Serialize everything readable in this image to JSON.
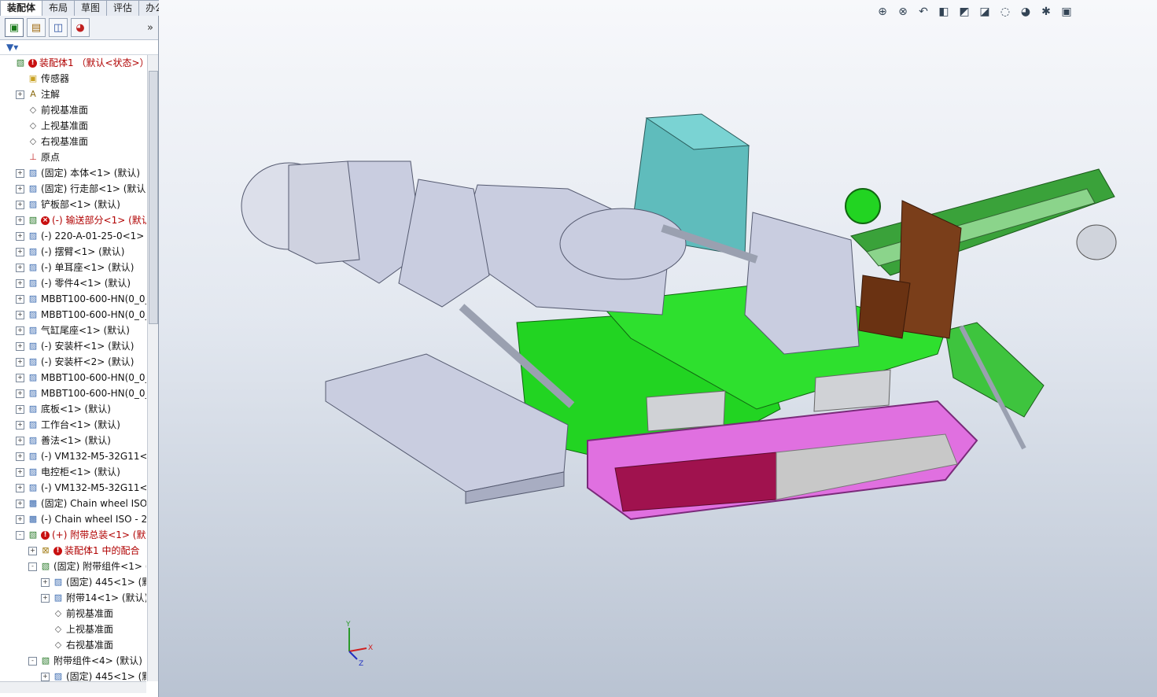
{
  "tabs": [
    "装配体",
    "布局",
    "草图",
    "评估",
    "办公室产品"
  ],
  "feature_tree": [
    {
      "label": "装配体1 （默认<状态>）",
      "indent": 0,
      "expander": "",
      "icon": "assembly-icon",
      "error": true,
      "red": true
    },
    {
      "label": "传感器",
      "indent": 1,
      "expander": "",
      "icon": "sensor-folder-icon"
    },
    {
      "label": "注解",
      "indent": 1,
      "expander": "+",
      "icon": "annotations-icon"
    },
    {
      "label": "前视基准面",
      "indent": 1,
      "expander": "",
      "icon": "plane-icon"
    },
    {
      "label": "上视基准面",
      "indent": 1,
      "expander": "",
      "icon": "plane-icon"
    },
    {
      "label": "右视基准面",
      "indent": 1,
      "expander": "",
      "icon": "plane-icon"
    },
    {
      "label": "原点",
      "indent": 1,
      "expander": "",
      "icon": "origin-icon"
    },
    {
      "label": "(固定) 本体<1> (默认)",
      "indent": 1,
      "expander": "+",
      "icon": "component-icon"
    },
    {
      "label": "(固定) 行走部<1> (默认)",
      "indent": 1,
      "expander": "+",
      "icon": "component-icon"
    },
    {
      "label": "铲板部<1> (默认)",
      "indent": 1,
      "expander": "+",
      "icon": "component-icon"
    },
    {
      "label": "(-) 输送部分<1> (默认",
      "indent": 1,
      "expander": "+",
      "icon": "assembly-icon",
      "error_x": true,
      "red": true
    },
    {
      "label": "(-) 220-A-01-25-0<1> (",
      "indent": 1,
      "expander": "+",
      "icon": "component-icon"
    },
    {
      "label": "(-) 摆臂<1> (默认)",
      "indent": 1,
      "expander": "+",
      "icon": "component-icon"
    },
    {
      "label": "(-) 单耳座<1> (默认)",
      "indent": 1,
      "expander": "+",
      "icon": "component-icon"
    },
    {
      "label": "(-) 零件4<1> (默认)",
      "indent": 1,
      "expander": "+",
      "icon": "component-icon"
    },
    {
      "label": "MBBT100-600-HN(0_0_(",
      "indent": 1,
      "expander": "+",
      "icon": "component-icon"
    },
    {
      "label": "MBBT100-600-HN(0_0_(",
      "indent": 1,
      "expander": "+",
      "icon": "component-icon"
    },
    {
      "label": "气缸尾座<1> (默认)",
      "indent": 1,
      "expander": "+",
      "icon": "component-icon"
    },
    {
      "label": "(-) 安装杆<1> (默认)",
      "indent": 1,
      "expander": "+",
      "icon": "component-icon"
    },
    {
      "label": "(-) 安装杆<2> (默认)",
      "indent": 1,
      "expander": "+",
      "icon": "component-icon"
    },
    {
      "label": "MBBT100-600-HN(0_0_(",
      "indent": 1,
      "expander": "+",
      "icon": "component-icon"
    },
    {
      "label": "MBBT100-600-HN(0_0_(",
      "indent": 1,
      "expander": "+",
      "icon": "component-icon"
    },
    {
      "label": "底板<1> (默认)",
      "indent": 1,
      "expander": "+",
      "icon": "component-icon"
    },
    {
      "label": "工作台<1> (默认)",
      "indent": 1,
      "expander": "+",
      "icon": "component-icon"
    },
    {
      "label": "善法<1> (默认)",
      "indent": 1,
      "expander": "+",
      "icon": "component-icon"
    },
    {
      "label": "(-) VM132-M5-32G11<1",
      "indent": 1,
      "expander": "+",
      "icon": "component-icon"
    },
    {
      "label": "电控柜<1> (默认)",
      "indent": 1,
      "expander": "+",
      "icon": "component-icon"
    },
    {
      "label": "(-) VM132-M5-32G11<2",
      "indent": 1,
      "expander": "+",
      "icon": "component-icon"
    },
    {
      "label": "(固定) Chain wheel ISO -",
      "indent": 1,
      "expander": "+",
      "icon": "part-icon"
    },
    {
      "label": "(-) Chain wheel ISO - 21",
      "indent": 1,
      "expander": "+",
      "icon": "part-icon"
    },
    {
      "label": "(+) 附带总装<1> (默认",
      "indent": 1,
      "expander": "-",
      "icon": "assembly-icon",
      "error": true,
      "red": true
    },
    {
      "label": "装配体1 中的配合",
      "indent": 2,
      "expander": "+",
      "icon": "mates-icon",
      "error": true,
      "red": true
    },
    {
      "label": "(固定) 附带组件<1> (",
      "indent": 2,
      "expander": "-",
      "icon": "assembly-icon"
    },
    {
      "label": "(固定) 445<1> (默",
      "indent": 3,
      "expander": "+",
      "icon": "component-icon"
    },
    {
      "label": "附带14<1> (默认)",
      "indent": 3,
      "expander": "+",
      "icon": "component-icon"
    },
    {
      "label": "前视基准面",
      "indent": 3,
      "expander": "",
      "icon": "plane-icon"
    },
    {
      "label": "上视基准面",
      "indent": 3,
      "expander": "",
      "icon": "plane-icon"
    },
    {
      "label": "右视基准面",
      "indent": 3,
      "expander": "",
      "icon": "plane-icon"
    },
    {
      "label": "附带组件<4> (默认)",
      "indent": 2,
      "expander": "-",
      "icon": "assembly-icon"
    },
    {
      "label": "(固定) 445<1> (默",
      "indent": 3,
      "expander": "+",
      "icon": "component-icon"
    }
  ],
  "triad": {
    "y": "Y",
    "x": "X",
    "z": "Z"
  },
  "colors": {
    "machine_green": "#22d422",
    "track_pink": "#e070e0",
    "arm_gray": "#c9cde0",
    "box_teal": "#5fbcbc",
    "seat_brown": "#7a3e1a",
    "track_red": "#a0124e"
  }
}
